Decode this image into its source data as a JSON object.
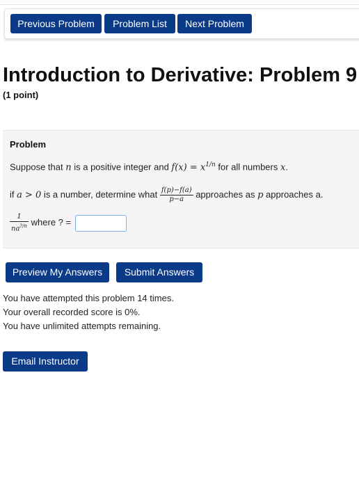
{
  "nav": {
    "previous_label": "Previous Problem",
    "list_label": "Problem List",
    "next_label": "Next Problem"
  },
  "header": {
    "title": "Introduction to Derivative: Problem 9",
    "points": "(1 point)"
  },
  "problem": {
    "heading": "Problem",
    "line1": {
      "t1": "Suppose that ",
      "n": "n",
      "t2": " is a positive integer and ",
      "eq": "f(x) = x",
      "exp": "1/n",
      "t3": " for all numbers ",
      "x": "x",
      "t4": "."
    },
    "line2": {
      "t1": "if ",
      "cond": "a > 0",
      "t2": " is a number, determine what ",
      "frac_num": "f(p)−f(a)",
      "frac_den": "p−a",
      "t3": " approaches as ",
      "p": "p",
      "t4": " approaches a."
    },
    "line3": {
      "frac_num": "1",
      "frac_den_base": "na",
      "frac_den_exp": "?/n",
      "t1": " where ? = "
    },
    "answer_value": ""
  },
  "actions": {
    "preview_label": "Preview My Answers",
    "submit_label": "Submit Answers"
  },
  "status": {
    "attempts": "You have attempted this problem 14 times.",
    "score": "Your overall recorded score is 0%.",
    "remaining": "You have unlimited attempts remaining."
  },
  "footer": {
    "email_label": "Email Instructor"
  },
  "colors": {
    "button_bg": "#0a3a88",
    "panel_bg": "#f5f5f5",
    "input_border": "#7ab0e6"
  }
}
